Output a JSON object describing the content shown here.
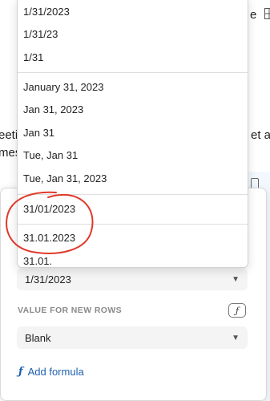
{
  "background": {
    "left_fragment_1": "eeti",
    "left_fragment_2": "mes",
    "right_fragment": "et an",
    "top_right_fragment": "e"
  },
  "menu": {
    "group_1": [
      "1/31/2023",
      "1/31/23",
      "1/31"
    ],
    "group_2": [
      "January 31, 2023",
      "Jan 31, 2023",
      "Jan 31",
      "Tue, Jan 31",
      "Tue, Jan 31, 2023"
    ],
    "group_3": [
      "31/01/2023"
    ],
    "group_4": [
      "31.01.2023",
      "31.01."
    ]
  },
  "panel": {
    "format_value": "1/31/2023",
    "new_rows_label": "VALUE FOR NEW ROWS",
    "new_rows_value": "Blank",
    "formula_icon": "formula-icon",
    "add_formula_label": "Add formula"
  },
  "colors": {
    "annotation": "#e0392b",
    "link": "#1d5fb0"
  }
}
